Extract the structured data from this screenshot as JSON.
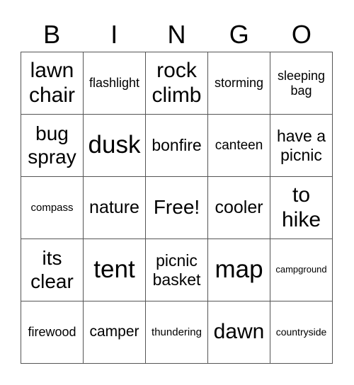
{
  "header": {
    "letters": [
      "B",
      "I",
      "N",
      "G",
      "O"
    ]
  },
  "card": {
    "rows": [
      [
        "lawn chair",
        "flashlight",
        "rock climb",
        "storming",
        "sleeping bag"
      ],
      [
        "bug spray",
        "dusk",
        "bonfire",
        "canteen",
        "have a picnic"
      ],
      [
        "compass",
        "nature",
        "Free!",
        "cooler",
        "to hike"
      ],
      [
        "its clear",
        "tent",
        "picnic basket",
        "map",
        "campground"
      ],
      [
        "firewood",
        "camper",
        "thundering",
        "dawn",
        "countryside"
      ]
    ],
    "free_space": "Free!"
  }
}
